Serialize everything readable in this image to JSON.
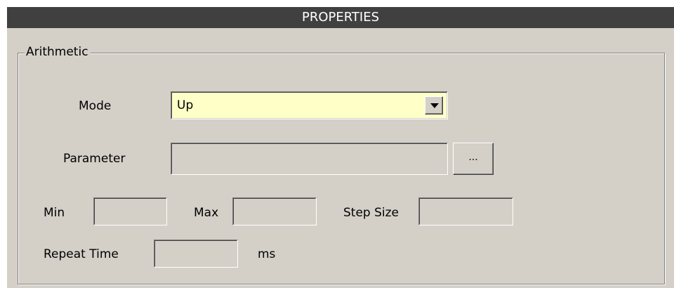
{
  "panel": {
    "title": "PROPERTIES"
  },
  "group": {
    "legend": "Arithmetic"
  },
  "mode": {
    "label": "Mode",
    "selected": "Up",
    "dropdown_icon": "chevron-down-icon"
  },
  "parameter": {
    "label": "Parameter",
    "value": "",
    "browse_label": "..."
  },
  "min": {
    "label": "Min",
    "value": ""
  },
  "max": {
    "label": "Max",
    "value": ""
  },
  "step": {
    "label": "Step Size",
    "value": ""
  },
  "repeat": {
    "label": "Repeat Time",
    "value": "",
    "unit": "ms"
  },
  "colors": {
    "titlebar": "#404040",
    "panel": "#d4d0c8",
    "combo_background": "#ffffc8"
  }
}
